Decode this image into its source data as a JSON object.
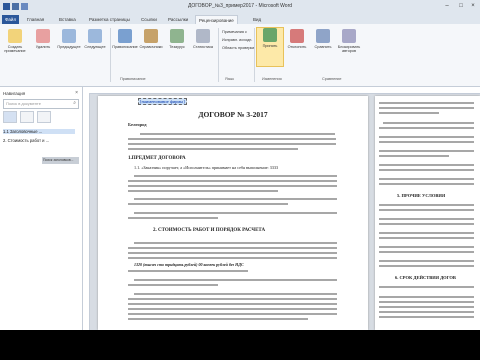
{
  "window": {
    "title": "ДОГОВОР_№3_пример2017 - Microsoft Word"
  },
  "tabs": [
    "Файл",
    "Главная",
    "Вставка",
    "Разметка страницы",
    "Ссылки",
    "Рассылки",
    "Рецензирование",
    "Вид"
  ],
  "ribbon": {
    "buttons": [
      "Создать примечание",
      "Удалить",
      "Предыдущее",
      "Следующее",
      "Правописание",
      "Справочники",
      "Тезаурус",
      "Статистика",
      "Перевод",
      "Выбрать язык",
      "Исправления",
      "Показать исправления",
      "Сравнить",
      "Блокировать авторов",
      "Ограничить редактирование",
      "Принять",
      "Отклонить",
      "Предыдущее",
      "Следующее"
    ],
    "small": [
      "Примечания с",
      "Исправл. исходн.",
      "Область проверки"
    ],
    "groups": [
      "Правописание",
      "Язык",
      "Примечания",
      "Запись исправлений",
      "Изменения",
      "Сравнение",
      "Защитить"
    ]
  },
  "nav": {
    "header": "Навигация",
    "search_placeholder": "Поиск в документе",
    "items": [
      "1.1 Заголовочные ...",
      "1.2 ...",
      "2. Стоимость работ и ...",
      "3. ...",
      "4 ..."
    ],
    "gray_label": "Поиск заголовков..."
  },
  "doc": {
    "field_label": "[наименование фирмы]",
    "title": "ДОГОВОР  № 3-2017",
    "city": "Белгород",
    "section1": "1.ПРЕДМЕТ ДОГОВОРА",
    "section2": "2. СТОИМОСТЬ РАБОТ И ПОРЯДОК РАСЧЕТА",
    "line_customer": "именуемое в дальнейшем «Заказчик» с одной стороны, и ООО \"Наша организация\", именуемое в дальнейшем «Исполнитель» в лице Плеховец Владимира",
    "line_11": "1.1. «Заказчик» поручает, а «Исполнитель» принимает на себя выполнение:   3333",
    "line_sum": "1320 (тысяч сто тридцать рублей) 00 копеек рублей без НДС",
    "right_5": "5. ПРОЧИЕ УСЛОВИЯ",
    "right_6": "6. СРОК ДЕЙСТВИЯ ДОГОВ"
  },
  "colors": {
    "file_tab": "#2b579a",
    "highlight": "#fde9a8"
  }
}
